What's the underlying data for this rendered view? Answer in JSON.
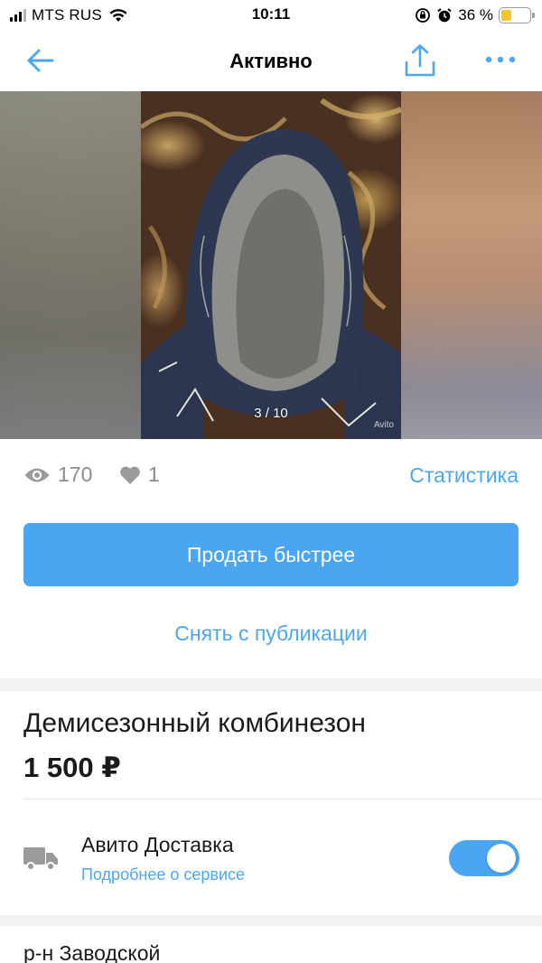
{
  "status_bar": {
    "carrier": "MTS RUS",
    "time": "10:11",
    "battery_percent": "36 %",
    "battery_level": 0.36,
    "icons": [
      "signal-icon",
      "wifi-icon",
      "orientation-lock-icon",
      "alarm-icon",
      "battery-icon"
    ]
  },
  "nav": {
    "title": "Активно",
    "back_icon": "arrow-left-icon",
    "share_icon": "share-icon",
    "more_icon": "more-dots-icon"
  },
  "gallery": {
    "counter": "3 / 10",
    "watermark": "Avito"
  },
  "stats": {
    "views": "170",
    "likes": "1",
    "link_label": "Статистика"
  },
  "actions": {
    "sell_faster_label": "Продать быстрее",
    "unpublish_label": "Снять с публикации"
  },
  "item": {
    "title": "Демисезонный комбинезон",
    "price": "1 500 ₽"
  },
  "delivery": {
    "title": "Авито Доставка",
    "link": "Подробнее о сервисе",
    "enabled": true
  },
  "location": {
    "text": "р-н Заводской"
  },
  "colors": {
    "accent": "#4aa6f1",
    "link": "#4da6f0",
    "muted": "#8c8c8c",
    "battery": "#f5c52b"
  }
}
